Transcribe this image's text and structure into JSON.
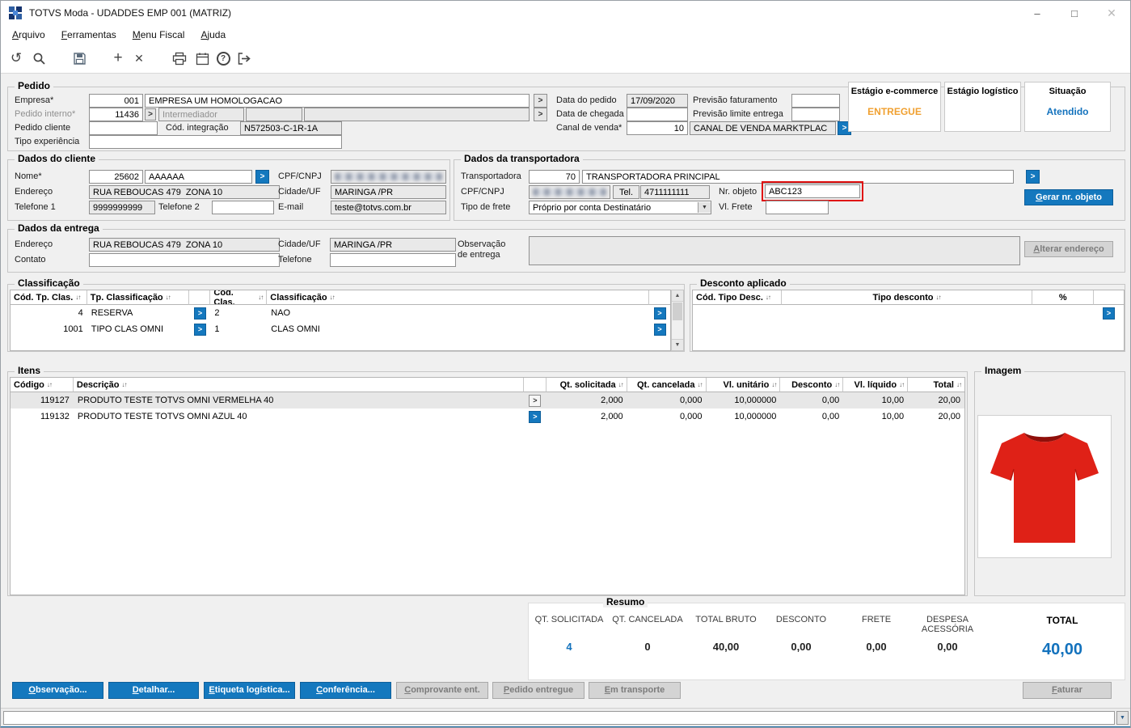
{
  "ui": {
    "sort": "↓↑",
    "lookup": ">",
    "dropdown": "▼",
    "minimize": "–",
    "maximize": "□",
    "close": "✕",
    "undo": "↺",
    "plus": "+",
    "x": "✕",
    "scroll_up": "▲",
    "scroll_down": "▼",
    "help": "?"
  },
  "window": {
    "title": "TOTVS Moda - UDADDES EMP 001 (MATRIZ)"
  },
  "menu": {
    "items": [
      {
        "label": "Arquivo"
      },
      {
        "label": "Ferramentas"
      },
      {
        "label": "Menu Fiscal"
      },
      {
        "label": "Ajuda"
      }
    ]
  },
  "pedido": {
    "title": "Pedido",
    "empresa_label": "Empresa*",
    "empresa_code": "001",
    "empresa_nome": "EMPRESA UM HOMOLOGACAO",
    "pedido_interno_label": "Pedido interno*",
    "pedido_interno": "11436",
    "intermediador_label": "Intermediador",
    "pedido_cliente_label": "Pedido cliente",
    "cod_integracao_label": "Cód. integração",
    "cod_integracao": "N572503-C-1R-1A",
    "tipo_experiencia_label": "Tipo experiência",
    "data_pedido_label": "Data do pedido",
    "data_pedido": "17/09/2020",
    "data_chegada_label": "Data de chegada",
    "canal_venda_label": "Canal de venda*",
    "canal_venda_code": "10",
    "canal_venda_nome": "CANAL DE VENDA MARKTPLAC",
    "previsao_faturamento_label": "Previsão faturamento",
    "previsao_limite_label": "Previsão limite entrega",
    "estagio_ecommerce_label": "Estágio e-commerce",
    "estagio_ecommerce": "ENTREGUE",
    "estagio_logistico_label": "Estágio logístico",
    "situacao_label": "Situação",
    "situacao": "Atendido"
  },
  "cliente": {
    "title": "Dados do cliente",
    "nome_label": "Nome*",
    "nome_code": "25602",
    "nome": "AAAAAA",
    "cpf_label": "CPF/CNPJ",
    "endereco_label": "Endereço",
    "endereco": "RUA REBOUCAS 479  ZONA 10",
    "cidade_label": "Cidade/UF",
    "cidade": "MARINGA /PR",
    "telefone1_label": "Telefone 1",
    "telefone1": "9999999999",
    "telefone2_label": "Telefone 2",
    "email_label": "E-mail",
    "email": "teste@totvs.com.br"
  },
  "transportadora": {
    "title": "Dados da transportadora",
    "transportadora_label": "Transportadora",
    "transportadora_code": "70",
    "transportadora_nome": "TRANSPORTADORA PRINCIPAL",
    "cpf_label": "CPF/CNPJ",
    "tel_label": "Tel.",
    "tel": "4711111111",
    "nr_objeto_label": "Nr. objeto",
    "nr_objeto": "ABC123",
    "gerar_btn": "Gerar nr. objeto",
    "tipo_frete_label": "Tipo de frete",
    "tipo_frete": "Próprio por conta Destinatário",
    "vl_frete_label": "Vl. Frete"
  },
  "entrega": {
    "title": "Dados da entrega",
    "endereco_label": "Endereço",
    "endereco": "RUA REBOUCAS 479  ZONA 10",
    "contato_label": "Contato",
    "cidade_label": "Cidade/UF",
    "cidade": "MARINGA /PR",
    "telefone_label": "Telefone",
    "observacao_label": "Observação de entrega",
    "alterar_btn": "Alterar endereço"
  },
  "classificacao": {
    "title": "Classificação",
    "h_cod_tp": "Cód. Tp. Clas.",
    "h_tp": "Tp. Classificação",
    "h_cod": "Cód. Clas.",
    "h_clas": "Classificação",
    "rows": [
      {
        "cod_tp": "4",
        "tp": "RESERVA",
        "cod": "2",
        "clas": "NAO"
      },
      {
        "cod_tp": "1001",
        "tp": "TIPO CLAS OMNI",
        "cod": "1",
        "clas": "CLAS OMNI"
      }
    ]
  },
  "desconto": {
    "title": "Desconto aplicado",
    "h_cod": "Cód. Tipo Desc.",
    "h_tipo": "Tipo desconto",
    "h_pct": "%"
  },
  "itens": {
    "title": "Itens",
    "h_codigo": "Código",
    "h_descricao": "Descrição",
    "h_qt_sol": "Qt. solicitada",
    "h_qt_canc": "Qt. cancelada",
    "h_vl_unit": "Vl. unitário",
    "h_desconto": "Desconto",
    "h_vl_liq": "Vl. líquido",
    "h_total": "Total",
    "rows": [
      {
        "codigo": "119127",
        "descricao": "PRODUTO TESTE TOTVS OMNI VERMELHA 40",
        "qt_sol": "2,000",
        "qt_canc": "0,000",
        "vl_unit": "10,000000",
        "desconto": "0,00",
        "vl_liq": "10,00",
        "total": "20,00"
      },
      {
        "codigo": "119132",
        "descricao": "PRODUTO TESTE TOTVS OMNI AZUL 40",
        "qt_sol": "2,000",
        "qt_canc": "0,000",
        "vl_unit": "10,000000",
        "desconto": "0,00",
        "vl_liq": "10,00",
        "total": "20,00"
      }
    ]
  },
  "imagem": {
    "title": "Imagem"
  },
  "resumo": {
    "title": "Resumo",
    "qt_sol_label": "QT. SOLICITADA",
    "qt_sol": "4",
    "qt_canc_label": "QT. CANCELADA",
    "qt_canc": "0",
    "bruto_label": "TOTAL BRUTO",
    "bruto": "40,00",
    "desc_label": "DESCONTO",
    "desc": "0,00",
    "frete_label": "FRETE",
    "frete": "0,00",
    "despesa_label": "DESPESA ACESSÓRIA",
    "despesa": "0,00",
    "total_label": "TOTAL",
    "total": "40,00"
  },
  "footer": {
    "observacao": "Observação...",
    "detalhar": "Detalhar...",
    "etiqueta": "Etiqueta logística...",
    "conferencia": "Conferência...",
    "comprovante": "Comprovante ent.",
    "pedido_entregue": "Pedido entregue",
    "em_transporte": "Em transporte",
    "faturar": "Faturar"
  }
}
